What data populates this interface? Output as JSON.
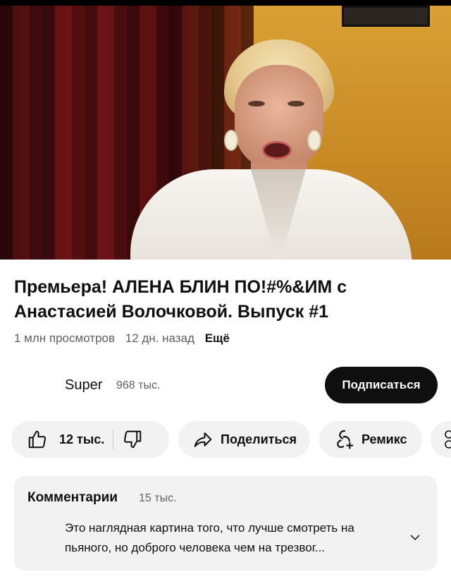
{
  "video": {
    "progress_percent": 1
  },
  "title": "Премьера! АЛЕНА БЛИН ПО!#%&ИМ с Анастасией Волочковой. Выпуск #1",
  "meta": {
    "views": "1 млн просмотров",
    "age": "12 дн. назад",
    "more": "Ещё"
  },
  "channel": {
    "name": "Super",
    "subscribers": "968 тыс.",
    "subscribe_label": "Подписаться"
  },
  "actions": {
    "likes": "12 тыс.",
    "share": "Поделиться",
    "remix": "Ремикс"
  },
  "comments": {
    "title": "Комментарии",
    "count": "15 тыс.",
    "top_comment": "Это наглядная картина того, что лучше смотреть на пьяного, но доброго человека чем на трезвог..."
  },
  "icons": {
    "like": "thumbs-up-icon",
    "dislike": "thumbs-down-icon",
    "share": "share-arrow-icon",
    "remix": "remix-icon",
    "expand": "chevron-down-icon"
  },
  "colors": {
    "accent": "#ff0000",
    "button_dark": "#0f0f0f",
    "pill_bg": "#f2f2f2",
    "secondary_text": "#606060"
  }
}
